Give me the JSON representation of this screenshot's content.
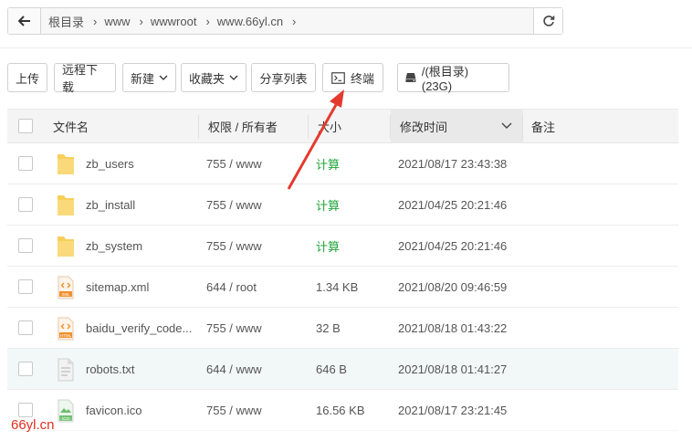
{
  "path": {
    "crumbs": [
      "根目录",
      "www",
      "wwwroot",
      "www.66yl.cn"
    ]
  },
  "toolbar": {
    "upload": "上传",
    "remote_download": "远程下载",
    "new": "新建",
    "favorites": "收藏夹",
    "share_list": "分享列表",
    "terminal": "终端",
    "disk": "/(根目录) (23G)"
  },
  "table": {
    "headers": {
      "name": "文件名",
      "perm": "权限 / 所有者",
      "size": "大小",
      "mtime": "修改时间",
      "note": "备注"
    },
    "rows": [
      {
        "name": "zb_users",
        "perm": "755 / www",
        "size": "计算",
        "mtime": "2021/08/17 23:43:38",
        "type": "folder"
      },
      {
        "name": "zb_install",
        "perm": "755 / www",
        "size": "计算",
        "mtime": "2021/04/25 20:21:46",
        "type": "folder"
      },
      {
        "name": "zb_system",
        "perm": "755 / www",
        "size": "计算",
        "mtime": "2021/04/25 20:21:46",
        "type": "folder"
      },
      {
        "name": "sitemap.xml",
        "perm": "644 / root",
        "size": "1.34 KB",
        "mtime": "2021/08/20 09:46:59",
        "type": "xml",
        "badge": "XML"
      },
      {
        "name": "baidu_verify_code...",
        "perm": "755 / www",
        "size": "32 B",
        "mtime": "2021/08/18 01:43:22",
        "type": "html",
        "badge": "HTML"
      },
      {
        "name": "robots.txt",
        "perm": "644 / www",
        "size": "646 B",
        "mtime": "2021/08/18 01:41:27",
        "type": "txt"
      },
      {
        "name": "favicon.ico",
        "perm": "755 / www",
        "size": "16.56 KB",
        "mtime": "2021/08/17 23:21:45",
        "type": "ico",
        "badge": "ICO"
      }
    ]
  },
  "watermark": "66yl.cn",
  "colors": {
    "calc_green": "#20a53a",
    "folder_yellow": "#f7cf5a",
    "arrow_red": "#e53a2e",
    "code_orange": "#f0902e",
    "highlight_row": "#f2f8f7"
  }
}
